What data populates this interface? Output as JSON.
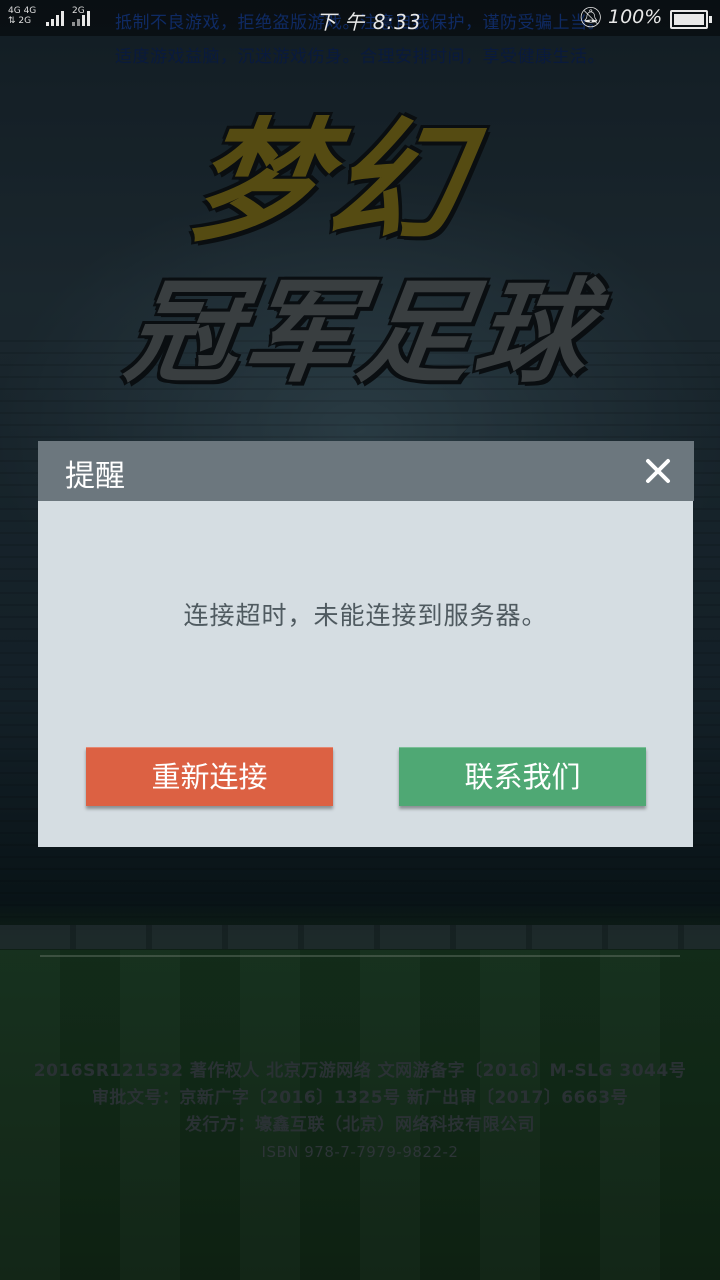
{
  "status_bar": {
    "network_labels": [
      "4G",
      "4G",
      "2G",
      "2G"
    ],
    "time": "下 午 8:33",
    "battery_text": "100%",
    "icons": [
      "signal-icon",
      "bell-off-icon",
      "battery-icon"
    ]
  },
  "notice": {
    "line1": "抵制不良游戏，拒绝盗版游戏。注意自我保护，谨防受骗上当。",
    "line2": "适度游戏益脑，沉迷游戏伤身。合理安排时间，享受健康生活。"
  },
  "logo": {
    "line1": "梦幻",
    "line2": "冠军足球"
  },
  "dialog": {
    "title": "提醒",
    "message": "连接超时，未能连接到服务器。",
    "retry_label": "重新连接",
    "contact_label": "联系我们",
    "colors": {
      "header": "#6c777e",
      "body": "#d5dde2",
      "retry": "#dc6143",
      "contact": "#4fa874"
    }
  },
  "copyright": {
    "line1": "2016SR121532 著作权人 北京万游网络 文网游备字〔2016〕M-SLG 3044号",
    "line2": "审批文号：京新广字〔2016〕1325号 新广出审〔2017〕6663号",
    "line3": "发行方：壕鑫互联（北京）网络科技有限公司",
    "line4": "ISBN 978-7-7979-9822-2"
  }
}
